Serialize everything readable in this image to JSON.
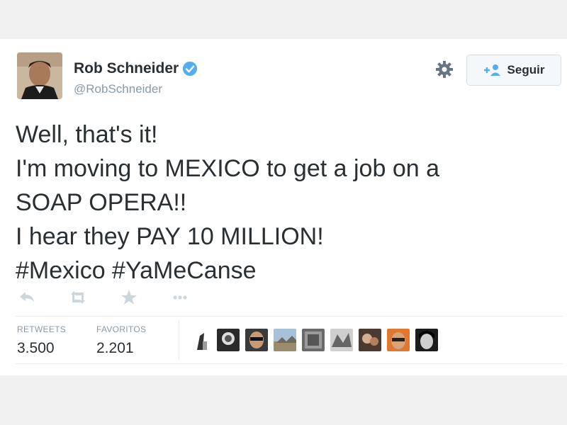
{
  "tweet": {
    "user": {
      "name": "Rob Schneider",
      "handle": "@RobSchneider",
      "verified": true
    },
    "follow_label": "Seguir",
    "text_lines": [
      "Well, that's it!",
      "I'm moving to MEXICO to get a job on a",
      "SOAP OPERA!!",
      "I hear they PAY 10 MILLION!",
      "#Mexico #YaMeCanse"
    ],
    "actions": [
      "reply-icon",
      "retweet-icon",
      "favorite-icon",
      "more-icon"
    ],
    "stats": {
      "retweets_label": "RETWEETS",
      "retweets_value": "3.500",
      "favorites_label": "FAVORITOS",
      "favorites_value": "2.201"
    },
    "favoriter_avatars": 10
  },
  "colors": {
    "background": "#f0f0f0",
    "card": "#ffffff",
    "text": "#292f33",
    "muted": "#8899a6",
    "verified": "#55acee",
    "action_icons": "#ccd6dd"
  }
}
